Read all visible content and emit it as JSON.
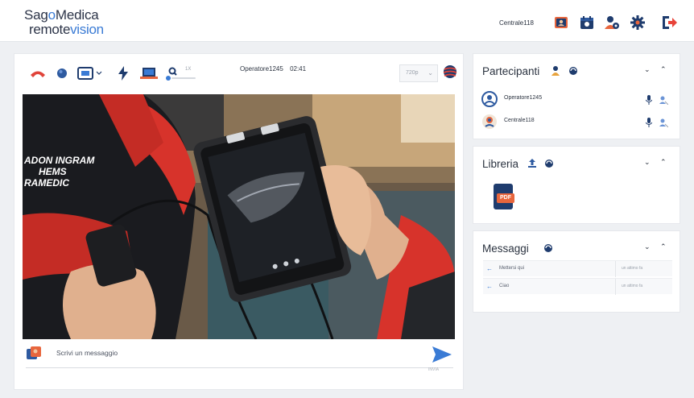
{
  "brand": {
    "line1_pre": "Sag",
    "line1_o": "o",
    "line1_post": "Medica",
    "line2_pre": "remote",
    "line2_post": "vision"
  },
  "header": {
    "user": "Centrale118"
  },
  "toolbar": {
    "operator": "Operatore1245",
    "time": "02:41",
    "quality": "720p",
    "zoom_value": "1X"
  },
  "chat": {
    "placeholder": "Scrivi un messaggio",
    "send_caption": "INVIA"
  },
  "participants": {
    "title": "Partecipanti",
    "items": [
      {
        "name": "Operatore1245"
      },
      {
        "name": "Centrale118"
      }
    ]
  },
  "library": {
    "title": "Libreria",
    "file_badge": "PDF"
  },
  "messages": {
    "title": "Messaggi",
    "items": [
      {
        "text": "Mettersi qui",
        "time": "un attimo fa"
      },
      {
        "text": "Ciao",
        "time": "un attimo fa"
      }
    ]
  },
  "video_overlay": {
    "vest_line1": "ADON INGRAM",
    "vest_line2": "HEMS",
    "vest_line3": "RAMEDIC"
  },
  "colors": {
    "accent": "#3a7bd5",
    "hangup": "#e0443a",
    "brand_dark": "#2c3448"
  },
  "icons": [
    "profile-card-icon",
    "calendar-icon",
    "user-settings-icon",
    "gear-icon",
    "logout-icon",
    "hangup-icon",
    "record-icon",
    "screen-share-icon",
    "flash-icon",
    "laptop-icon",
    "zoom-icon",
    "globe-icon",
    "send-icon"
  ]
}
